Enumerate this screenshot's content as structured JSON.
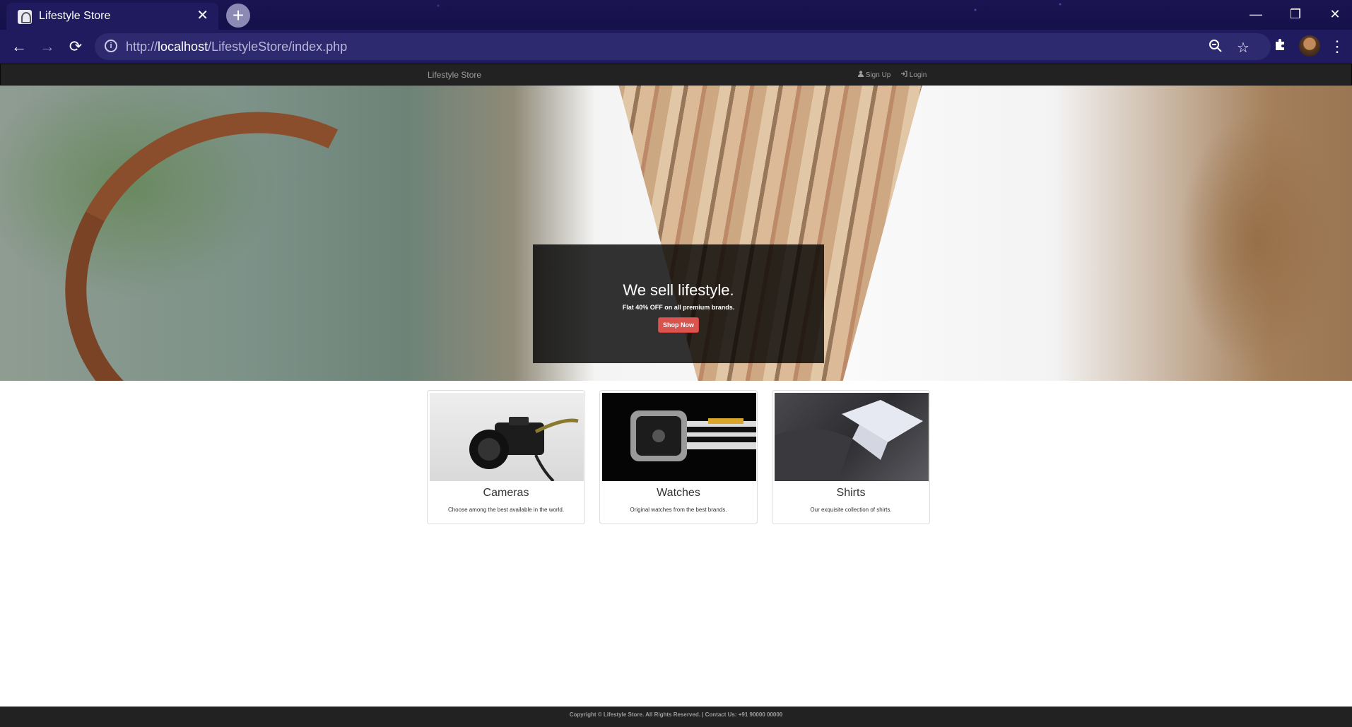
{
  "browser": {
    "tab_title": "Lifestyle Store",
    "tab_close": "✕",
    "new_tab": "+",
    "url_scheme": "http://",
    "url_host": "localhost",
    "url_path": "/LifestyleStore/index.php",
    "window_controls": {
      "minimize": "—",
      "restore": "❐",
      "close": "✕"
    }
  },
  "navbar": {
    "brand": "Lifestyle Store",
    "links": [
      {
        "icon": "user-icon",
        "label": "Sign Up"
      },
      {
        "icon": "login-icon",
        "label": "Login"
      }
    ]
  },
  "hero": {
    "title": "We sell lifestyle.",
    "subtitle": "Flat 40% OFF on all premium brands.",
    "button": "Shop Now"
  },
  "products": [
    {
      "name": "Cameras",
      "description": "Choose among the best available in the world."
    },
    {
      "name": "Watches",
      "description": "Original watches from the best brands."
    },
    {
      "name": "Shirts",
      "description": "Our exquisite collection of shirts."
    }
  ],
  "footer": {
    "text": "Copyright © Lifestyle Store. All Rights Reserved. | Contact Us: +91 90000 00000"
  },
  "colors": {
    "browser_bg": "#1b1452",
    "navbar_bg": "#222222",
    "button_red": "#d9534f"
  }
}
